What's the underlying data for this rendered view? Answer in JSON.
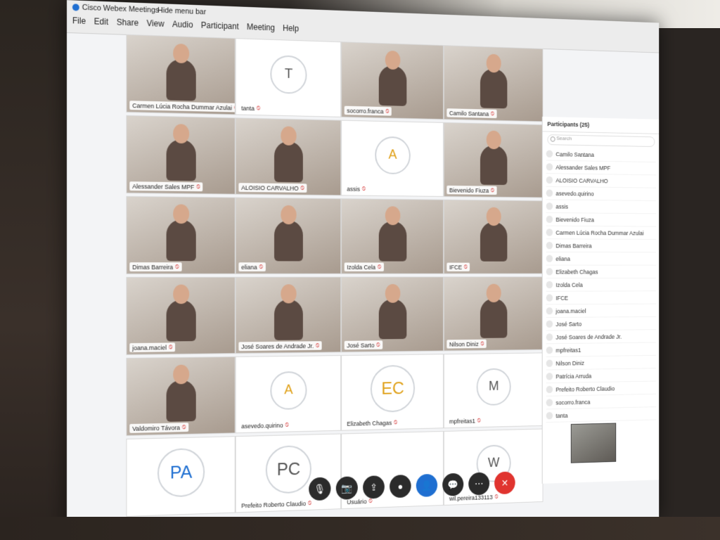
{
  "app": {
    "title": "Cisco Webex Meetings",
    "hide_menu_bar": "Hide menu bar",
    "menu": [
      "File",
      "Edit",
      "Share",
      "View",
      "Audio",
      "Participant",
      "Meeting",
      "Help"
    ]
  },
  "tiles": [
    {
      "name": "Carmen Lúcia Rocha Dummar Azulai",
      "type": "video"
    },
    {
      "name": "tanta",
      "type": "avatar",
      "initials": "T"
    },
    {
      "name": "socorro.franca",
      "type": "video"
    },
    {
      "name": "Camilo Santana",
      "type": "video"
    },
    {
      "name": "Alessander Sales MPF",
      "type": "video"
    },
    {
      "name": "ALOISIO CARVALHO",
      "type": "video"
    },
    {
      "name": "assis",
      "type": "avatar",
      "initials": "A"
    },
    {
      "name": "Bievenido Fiuza",
      "type": "video"
    },
    {
      "name": "Dimas Barreira",
      "type": "video"
    },
    {
      "name": "eliana",
      "type": "video"
    },
    {
      "name": "Izolda Cela",
      "type": "video"
    },
    {
      "name": "IFCE",
      "type": "video"
    },
    {
      "name": "joana.maciel",
      "type": "video"
    },
    {
      "name": "José Soares de Andrade Jr.",
      "type": "video"
    },
    {
      "name": "José Sarto",
      "type": "video"
    },
    {
      "name": "Nilson Diniz",
      "type": "video"
    },
    {
      "name": "Valdomiro Távora",
      "type": "video"
    },
    {
      "name": "asevedo.quirino",
      "type": "avatar",
      "initials": "A"
    },
    {
      "name": "Elizabeth Chagas",
      "type": "avatar",
      "initials": "EC"
    },
    {
      "name": "mpfreitas1",
      "type": "avatar",
      "initials": "M"
    },
    {
      "name": "",
      "type": "avatar",
      "initials": "PA"
    },
    {
      "name": "Prefeito Roberto Claudio",
      "type": "avatar",
      "initials": "PC"
    },
    {
      "name": "Usuário",
      "type": "blank"
    },
    {
      "name": "wil.pereira133113",
      "type": "avatar",
      "initials": "W"
    }
  ],
  "panel": {
    "title": "Participants (25)",
    "search_placeholder": "Search",
    "participants": [
      "Camilo Santana",
      "Alessander Sales MPF",
      "ALOISIO CARVALHO",
      "asevedo.quirino",
      "assis",
      "Bievenido Fiuza",
      "Carmen Lúcia Rocha Dummar Azulai",
      "Dimas Barreira",
      "eliana",
      "Elizabeth Chagas",
      "Izolda Cela",
      "IFCE",
      "joana.maciel",
      "José Sarto",
      "José Soares de Andrade Jr.",
      "mpfreitas1",
      "Nilson Diniz",
      "Patrícia Arruda",
      "Prefeito Roberto Claudio",
      "socorro.franca",
      "tanta"
    ]
  },
  "controls": [
    {
      "name": "mute-button",
      "icon": "mic-off-icon",
      "glyph": "🎙",
      "style": ""
    },
    {
      "name": "video-button",
      "icon": "camera-off-icon",
      "glyph": "📷",
      "style": ""
    },
    {
      "name": "share-button",
      "icon": "share-icon",
      "glyph": "⇪",
      "style": ""
    },
    {
      "name": "record-button",
      "icon": "record-icon",
      "glyph": "●",
      "style": ""
    },
    {
      "name": "participants-button",
      "icon": "people-icon",
      "glyph": "👤",
      "style": "blue"
    },
    {
      "name": "chat-button",
      "icon": "chat-icon",
      "glyph": "💬",
      "style": ""
    },
    {
      "name": "more-button",
      "icon": "more-icon",
      "glyph": "⋯",
      "style": ""
    },
    {
      "name": "leave-button",
      "icon": "close-icon",
      "glyph": "✕",
      "style": "red"
    }
  ],
  "colors": {
    "accent": "#1f6fd1",
    "leave": "#e0342f"
  }
}
